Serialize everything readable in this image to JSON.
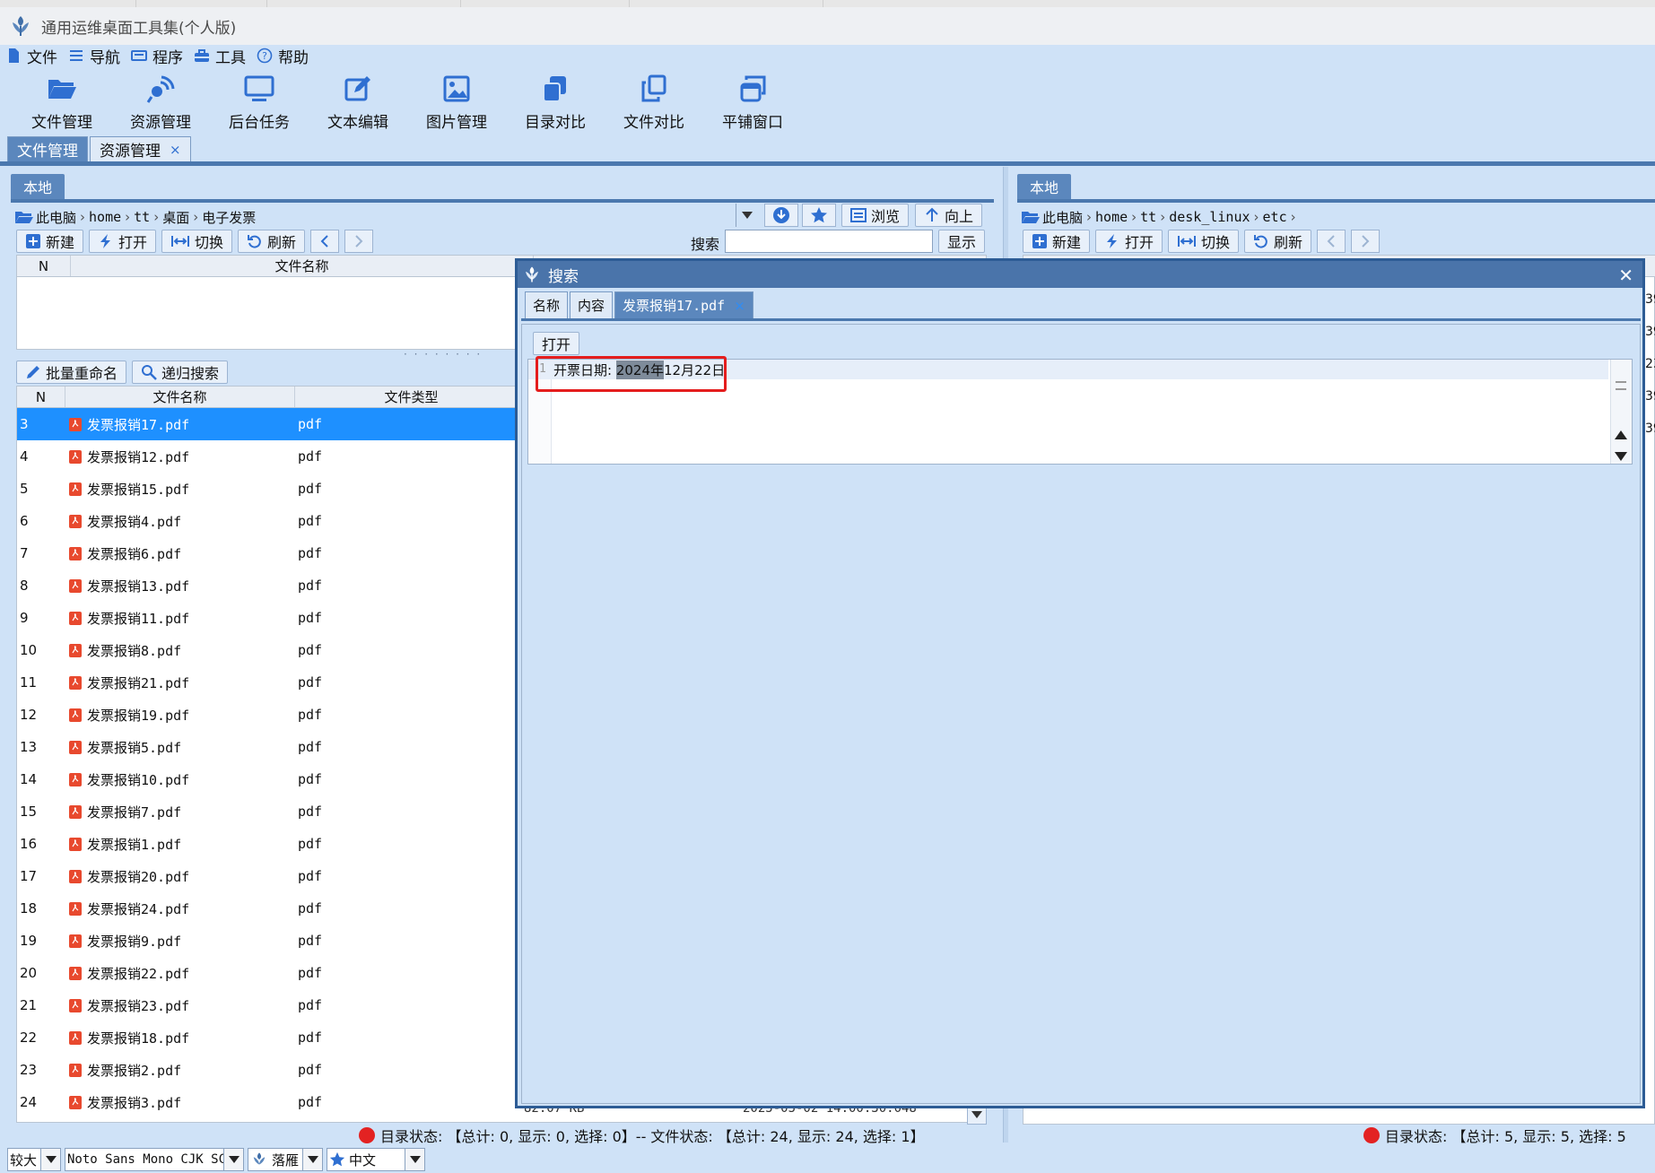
{
  "app": {
    "title": "通用运维桌面工具集(个人版)"
  },
  "menu": [
    {
      "label": "文件",
      "icon": "file-icon"
    },
    {
      "label": "导航",
      "icon": "list-icon"
    },
    {
      "label": "程序",
      "icon": "keyboard-icon"
    },
    {
      "label": "工具",
      "icon": "toolbox-icon"
    },
    {
      "label": "帮助",
      "icon": "help-icon"
    }
  ],
  "toolbar": [
    {
      "label": "文件管理",
      "icon": "folder-open-icon"
    },
    {
      "label": "资源管理",
      "icon": "satellite-icon"
    },
    {
      "label": "后台任务",
      "icon": "monitor-icon"
    },
    {
      "label": "文本编辑",
      "icon": "edit-icon"
    },
    {
      "label": "图片管理",
      "icon": "image-icon"
    },
    {
      "label": "目录对比",
      "icon": "copy-icon"
    },
    {
      "label": "文件对比",
      "icon": "clone-icon"
    },
    {
      "label": "平铺窗口",
      "icon": "windows-icon"
    }
  ],
  "outer_tabs": [
    {
      "label": "文件管理",
      "active": true
    },
    {
      "label": "资源管理",
      "close": "×"
    }
  ],
  "left_panel": {
    "tab": "本地",
    "breadcrumb": [
      "此电脑",
      "home",
      "tt",
      "桌面",
      "电子发票"
    ],
    "nav_buttons": {
      "browse": "浏览",
      "up": "向上"
    },
    "actions": {
      "new": "新建",
      "open": "打开",
      "switch": "切换",
      "refresh": "刷新"
    },
    "search_label": "搜索",
    "search_value": "",
    "show_button": "显示",
    "dir_table": {
      "col_n": "N",
      "col_name": "文件名称"
    },
    "batch_rename": "批量重命名",
    "recursive_search": "递归搜索",
    "file_table": {
      "col_n": "N",
      "col_name": "文件名称",
      "col_type": "文件类型",
      "rows": [
        {
          "n": "3",
          "name": "发票报销17.pdf",
          "type": "pdf"
        },
        {
          "n": "4",
          "name": "发票报销12.pdf",
          "type": "pdf"
        },
        {
          "n": "5",
          "name": "发票报销15.pdf",
          "type": "pdf"
        },
        {
          "n": "6",
          "name": "发票报销4.pdf",
          "type": "pdf"
        },
        {
          "n": "7",
          "name": "发票报销6.pdf",
          "type": "pdf"
        },
        {
          "n": "8",
          "name": "发票报销13.pdf",
          "type": "pdf"
        },
        {
          "n": "9",
          "name": "发票报销11.pdf",
          "type": "pdf"
        },
        {
          "n": "10",
          "name": "发票报销8.pdf",
          "type": "pdf"
        },
        {
          "n": "11",
          "name": "发票报销21.pdf",
          "type": "pdf"
        },
        {
          "n": "12",
          "name": "发票报销19.pdf",
          "type": "pdf"
        },
        {
          "n": "13",
          "name": "发票报销5.pdf",
          "type": "pdf"
        },
        {
          "n": "14",
          "name": "发票报销10.pdf",
          "type": "pdf"
        },
        {
          "n": "15",
          "name": "发票报销7.pdf",
          "type": "pdf"
        },
        {
          "n": "16",
          "name": "发票报销1.pdf",
          "type": "pdf"
        },
        {
          "n": "17",
          "name": "发票报销20.pdf",
          "type": "pdf"
        },
        {
          "n": "18",
          "name": "发票报销24.pdf",
          "type": "pdf"
        },
        {
          "n": "19",
          "name": "发票报销9.pdf",
          "type": "pdf"
        },
        {
          "n": "20",
          "name": "发票报销22.pdf",
          "type": "pdf"
        },
        {
          "n": "21",
          "name": "发票报销23.pdf",
          "type": "pdf"
        },
        {
          "n": "22",
          "name": "发票报销18.pdf",
          "type": "pdf"
        },
        {
          "n": "23",
          "name": "发票报销2.pdf",
          "type": "pdf"
        },
        {
          "n": "24",
          "name": "发票报销3.pdf",
          "type": "pdf"
        }
      ],
      "selected_index": 0
    },
    "partial_row": {
      "size": "82.07 KB",
      "time": "2025-05-02 14:00:30.048"
    },
    "status": "目录状态: 【总计: 0, 显示: 0, 选择: 0】-- 文件状态: 【总计: 24, 显示: 24, 选择: 1】"
  },
  "right_panel": {
    "tab": "本地",
    "breadcrumb": [
      "此电脑",
      "home",
      "tt",
      "desk_linux",
      "etc"
    ],
    "actions": {
      "new": "新建",
      "open": "打开",
      "switch": "切换",
      "refresh": "刷新"
    },
    "status": "目录状态: 【总计: 5, 显示: 5, 选择: 5",
    "edge_digits": [
      "39",
      "39",
      "23",
      "39",
      "39"
    ]
  },
  "search_dialog": {
    "title": "搜索",
    "close": "✕",
    "tabs": [
      {
        "label": "名称"
      },
      {
        "label": "内容"
      },
      {
        "label": "发票报销17.pdf",
        "active": true,
        "close": "×"
      }
    ],
    "open_button": "打开",
    "line_number": "1",
    "line_prefix": "开票日期: ",
    "highlight": "2024年",
    "line_suffix": "12月22日"
  },
  "bottom_bar": {
    "size_select": "较大",
    "font_select": "Noto Sans Mono CJK SC",
    "theme_select": "落雁",
    "lang_select": "中文"
  },
  "colors": {
    "accent": "#5b87bd",
    "selection": "#1e90ff",
    "highlight_box": "#e41d1d",
    "status_dot": "#e32222"
  }
}
